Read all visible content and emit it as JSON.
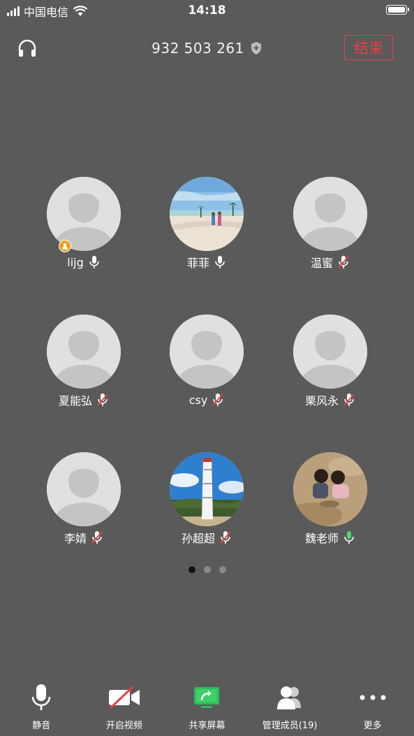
{
  "status_bar": {
    "carrier": "中国电信",
    "time": "14:18"
  },
  "header": {
    "meeting_id": "932 503 261",
    "end_label": "结束"
  },
  "participants": [
    {
      "name": "lijg",
      "mic": "on",
      "avatar": "placeholder",
      "host": true
    },
    {
      "name": "菲菲",
      "mic": "on",
      "avatar": "beach-photo",
      "host": false
    },
    {
      "name": "温蜜",
      "mic": "muted",
      "avatar": "placeholder",
      "host": false
    },
    {
      "name": "夏能弘",
      "mic": "muted",
      "avatar": "placeholder",
      "host": false
    },
    {
      "name": "csy",
      "mic": "muted",
      "avatar": "placeholder",
      "host": false
    },
    {
      "name": "栗风永",
      "mic": "muted",
      "avatar": "placeholder",
      "host": false
    },
    {
      "name": "李婧",
      "mic": "muted",
      "avatar": "placeholder",
      "host": false
    },
    {
      "name": "孙超超",
      "mic": "muted",
      "avatar": "tower-photo",
      "host": false
    },
    {
      "name": "魏老师",
      "mic": "speaking",
      "avatar": "kids-photo",
      "host": false
    }
  ],
  "pager": {
    "total": 3,
    "current": 1
  },
  "toolbar": {
    "mute_label": "静音",
    "video_label": "开启视频",
    "share_label": "共享屏幕",
    "members_label": "管理成员(19)",
    "more_label": "更多"
  },
  "colors": {
    "background": "#5a5a5a",
    "end": "#e84040",
    "speaking": "#4cd964",
    "share": "#2dbb5a",
    "host_badge": "#f0a020"
  }
}
